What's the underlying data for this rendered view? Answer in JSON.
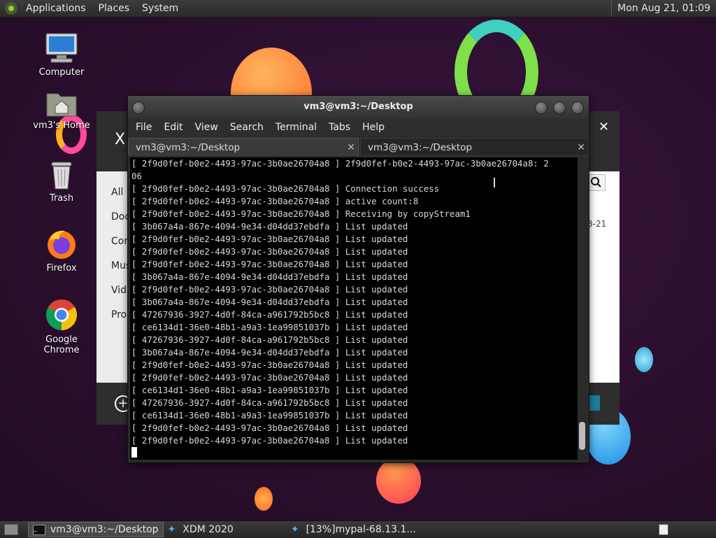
{
  "top_panel": {
    "menus": [
      "Applications",
      "Places",
      "System"
    ],
    "clock": "Mon Aug 21, 01:09"
  },
  "desktop_icons": [
    {
      "label": "Computer"
    },
    {
      "label": "vm3's Home"
    },
    {
      "label": "Trash"
    },
    {
      "label": "Firefox"
    },
    {
      "label": "Google Chrome"
    }
  ],
  "xdm_window": {
    "title_letter": "X",
    "close": "✕",
    "sidebar": [
      "All",
      "Doc",
      "Com",
      "Mus",
      "Vid",
      "Pro"
    ],
    "date_fragment": "3-21"
  },
  "terminal": {
    "title": "vm3@vm3:~/Desktop",
    "menu": [
      "File",
      "Edit",
      "View",
      "Search",
      "Terminal",
      "Tabs",
      "Help"
    ],
    "tabs": [
      {
        "label": "vm3@vm3:~/Desktop",
        "active": true
      },
      {
        "label": "vm3@vm3:~/Desktop",
        "active": false
      }
    ],
    "lines": [
      "[ 2f9d0fef-b0e2-4493-97ac-3b0ae26704a8 ] 2f9d0fef-b0e2-4493-97ac-3b0ae26704a8: 2",
      "06",
      "[ 2f9d0fef-b0e2-4493-97ac-3b0ae26704a8 ] Connection success",
      "[ 2f9d0fef-b0e2-4493-97ac-3b0ae26704a8 ] active count:8",
      "[ 2f9d0fef-b0e2-4493-97ac-3b0ae26704a8 ] Receiving by copyStream1",
      "[ 3b067a4a-867e-4094-9e34-d04dd37ebdfa ] List updated",
      "[ 2f9d0fef-b0e2-4493-97ac-3b0ae26704a8 ] List updated",
      "[ 2f9d0fef-b0e2-4493-97ac-3b0ae26704a8 ] List updated",
      "[ 2f9d0fef-b0e2-4493-97ac-3b0ae26704a8 ] List updated",
      "[ 3b067a4a-867e-4094-9e34-d04dd37ebdfa ] List updated",
      "[ 2f9d0fef-b0e2-4493-97ac-3b0ae26704a8 ] List updated",
      "[ 3b067a4a-867e-4094-9e34-d04dd37ebdfa ] List updated",
      "[ 47267936-3927-4d0f-84ca-a961792b5bc8 ] List updated",
      "[ ce6134d1-36e0-48b1-a9a3-1ea99851037b ] List updated",
      "[ 47267936-3927-4d0f-84ca-a961792b5bc8 ] List updated",
      "[ 3b067a4a-867e-4094-9e34-d04dd37ebdfa ] List updated",
      "[ 2f9d0fef-b0e2-4493-97ac-3b0ae26704a8 ] List updated",
      "[ 2f9d0fef-b0e2-4493-97ac-3b0ae26704a8 ] List updated",
      "[ ce6134d1-36e0-48b1-a9a3-1ea99851037b ] List updated",
      "[ 47267936-3927-4d0f-84ca-a961792b5bc8 ] List updated",
      "[ ce6134d1-36e0-48b1-a9a3-1ea99851037b ] List updated",
      "[ 2f9d0fef-b0e2-4493-97ac-3b0ae26704a8 ] List updated",
      "[ 2f9d0fef-b0e2-4493-97ac-3b0ae26704a8 ] List updated"
    ]
  },
  "taskbar": {
    "items": [
      {
        "label": "vm3@vm3:~/Desktop",
        "active": true
      },
      {
        "label": "XDM 2020",
        "active": false
      },
      {
        "label": "[13%]mypal-68.13.1...",
        "active": false
      }
    ]
  }
}
